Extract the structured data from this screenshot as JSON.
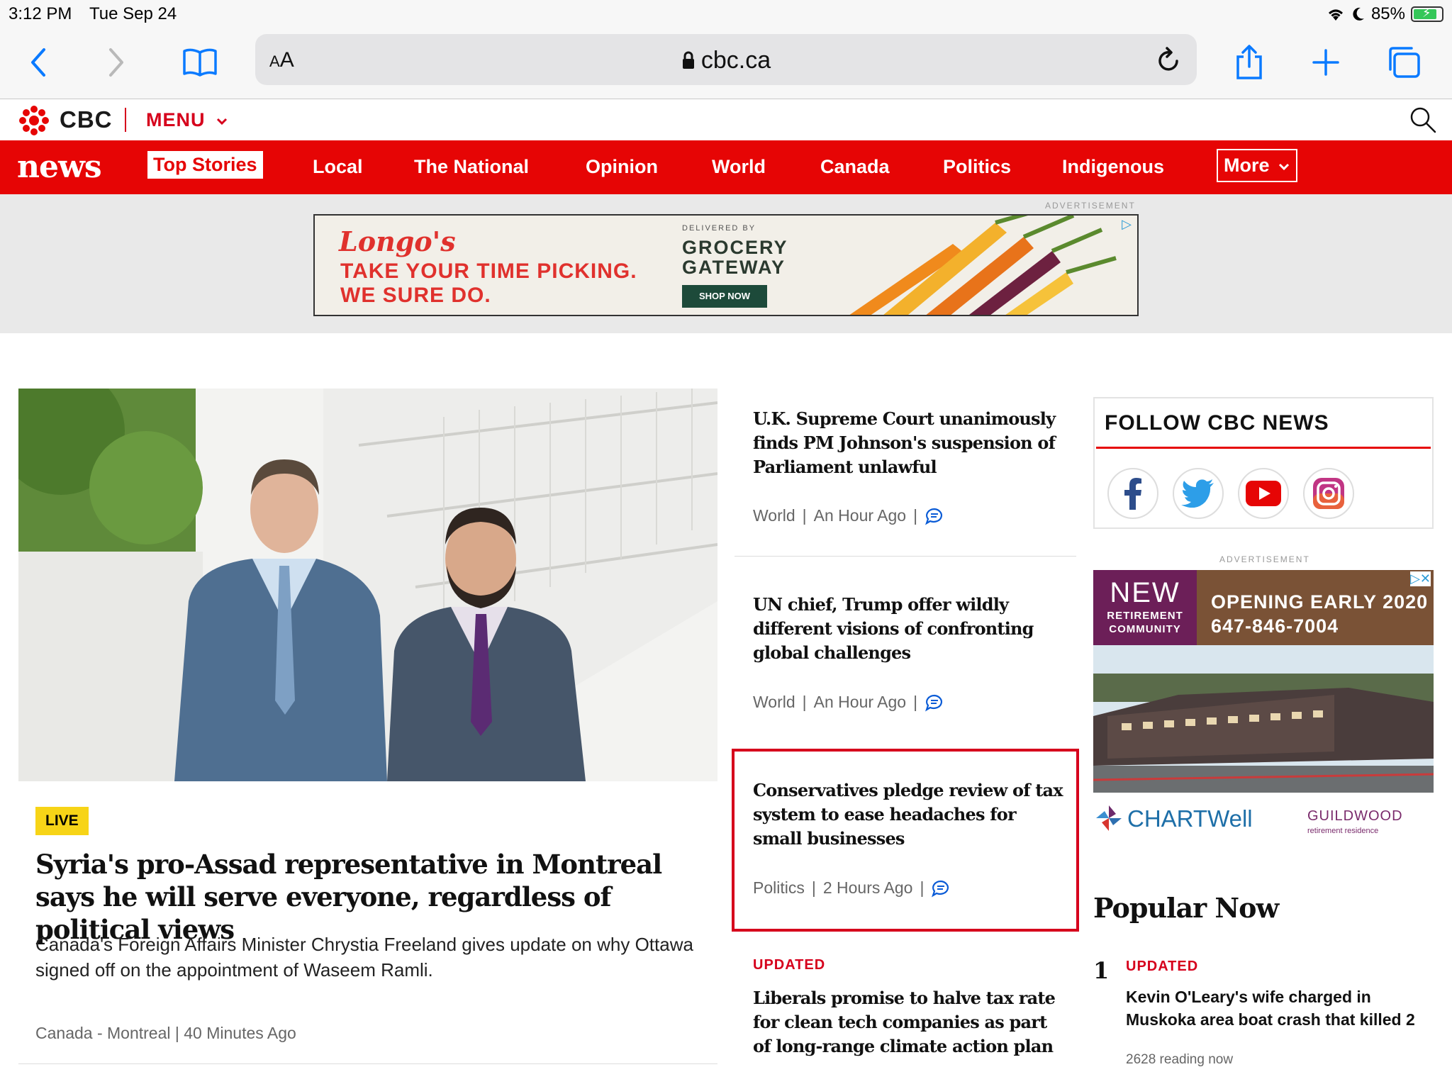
{
  "status_bar": {
    "time": "3:12 PM",
    "date": "Tue Sep 24",
    "battery": "85%",
    "battery_level": 0.85
  },
  "browser": {
    "text_size_label": "AA",
    "url": "cbc.ca"
  },
  "site_header": {
    "logo_text": "CBC",
    "menu_label": "MENU"
  },
  "news_nav": {
    "logo": "news",
    "items": [
      "Top Stories",
      "Local",
      "The National",
      "Opinion",
      "World",
      "Canada",
      "Politics",
      "Indigenous"
    ],
    "more_label": "More",
    "active": "Top Stories"
  },
  "top_ad": {
    "label": "ADVERTISEMENT",
    "brand": "Longo's",
    "line1": "TAKE YOUR TIME PICKING.",
    "line2": "WE SURE DO.",
    "delivered_by": "DELIVERED BY",
    "partner_line1": "GROCERY",
    "partner_line2": "GATEWAY",
    "cta": "SHOP NOW"
  },
  "hero": {
    "badge": "LIVE",
    "title": "Syria's pro-Assad representative in Montreal says he will serve everyone, regardless of political views",
    "description": "Canada's Foreign Affairs Minister Chrystia Freeland gives update on why Ottawa signed off on the appointment of Waseem Ramli.",
    "meta": "Canada  - Montreal  |  40 Minutes Ago"
  },
  "stories": [
    {
      "title": "U.K. Supreme Court unanimously finds PM Johnson's suspension of Parliament unlawful",
      "category": "World",
      "time": "An Hour Ago"
    },
    {
      "title": "UN chief, Trump offer wildly different visions of confronting global challenges",
      "category": "World",
      "time": "An Hour Ago"
    },
    {
      "title": "Conservatives pledge review of tax system to ease headaches for small businesses",
      "category": "Politics",
      "time": "2 Hours Ago"
    },
    {
      "badge": "UPDATED",
      "title": "Liberals promise to halve tax rate for clean tech companies as part of long-range climate action plan"
    }
  ],
  "follow": {
    "heading": "FOLLOW CBC NEWS",
    "networks": [
      "facebook-icon",
      "twitter-icon",
      "youtube-icon",
      "instagram-icon"
    ]
  },
  "side_ad": {
    "label": "ADVERTISEMENT",
    "new": "NEW",
    "new_sub1": "RETIREMENT",
    "new_sub2": "COMMUNITY",
    "headline": "OPENING EARLY 2020",
    "phone": "647-846-7004",
    "brand": "CHARTWell",
    "partner": "GUILDWOOD",
    "partner_sub": "retirement residence"
  },
  "popular": {
    "heading": "Popular Now",
    "items": [
      {
        "rank": "1",
        "badge": "UPDATED",
        "title": "Kevin O'Leary's wife charged in Muskoka area boat crash that killed 2",
        "reading": "2628 reading now"
      }
    ]
  },
  "colors": {
    "cbc_red": "#e60505",
    "live_yellow": "#f7d417",
    "link_blue": "#0a7aff"
  }
}
